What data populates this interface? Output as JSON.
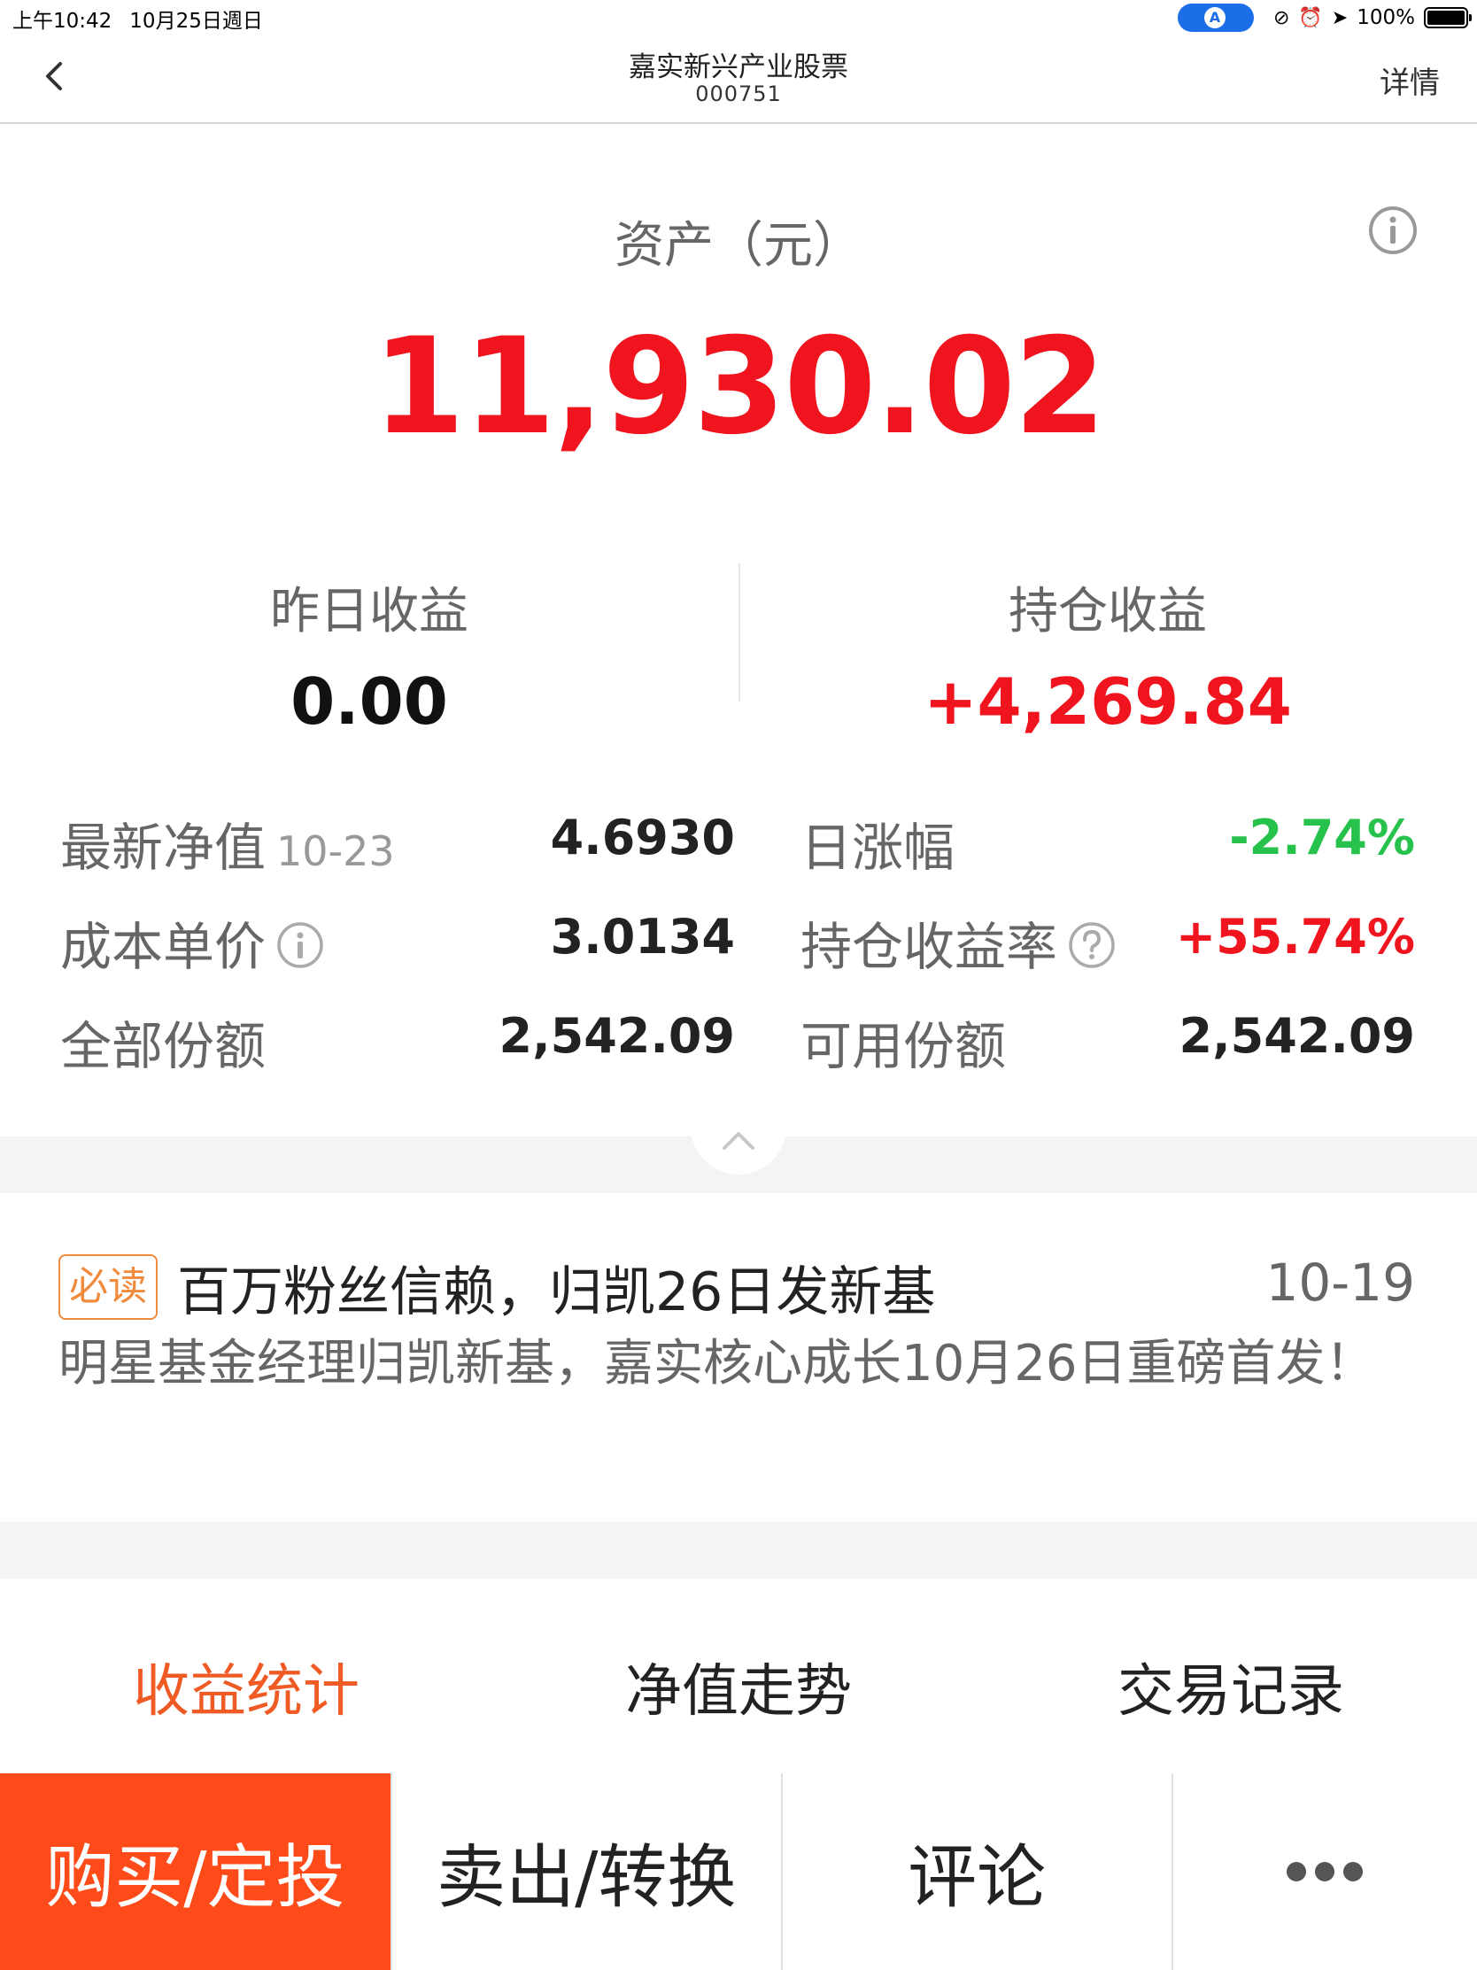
{
  "status_bar": {
    "time": "上午10:42",
    "date": "10月25日週日",
    "battery": "100%"
  },
  "nav": {
    "title": "嘉实新兴产业股票",
    "code": "000751",
    "detail": "详情"
  },
  "asset": {
    "label": "资产（元）",
    "value": "11,930.02"
  },
  "summary": {
    "yesterday_label": "昨日收益",
    "yesterday_value": "0.00",
    "holding_label": "持仓收益",
    "holding_value": "+4,269.84"
  },
  "details": {
    "nav_label": "最新净值",
    "nav_date": "10-23",
    "nav_value": "4.6930",
    "daily_label": "日涨幅",
    "daily_value": "-2.74%",
    "cost_label": "成本单价",
    "cost_value": "3.0134",
    "rate_label": "持仓收益率",
    "rate_value": "+55.74%",
    "total_label": "全部份额",
    "total_value": "2,542.09",
    "avail_label": "可用份额",
    "avail_value": "2,542.09"
  },
  "news": {
    "badge": "必读",
    "title": "百万粉丝信赖，归凯26日发新基",
    "date": "10-19",
    "body": "明星基金经理归凯新基，嘉实核心成长10月26日重磅首发！"
  },
  "tabs": [
    {
      "label": "收益统计"
    },
    {
      "label": "净值走势"
    },
    {
      "label": "交易记录"
    }
  ],
  "actions": {
    "buy": "购买/定投",
    "sell": "卖出/转换",
    "comment": "评论"
  },
  "colors": {
    "red": "#f0141e",
    "green": "#27c24c",
    "accent": "#ff4b1a",
    "badge": "#f08a3c"
  }
}
